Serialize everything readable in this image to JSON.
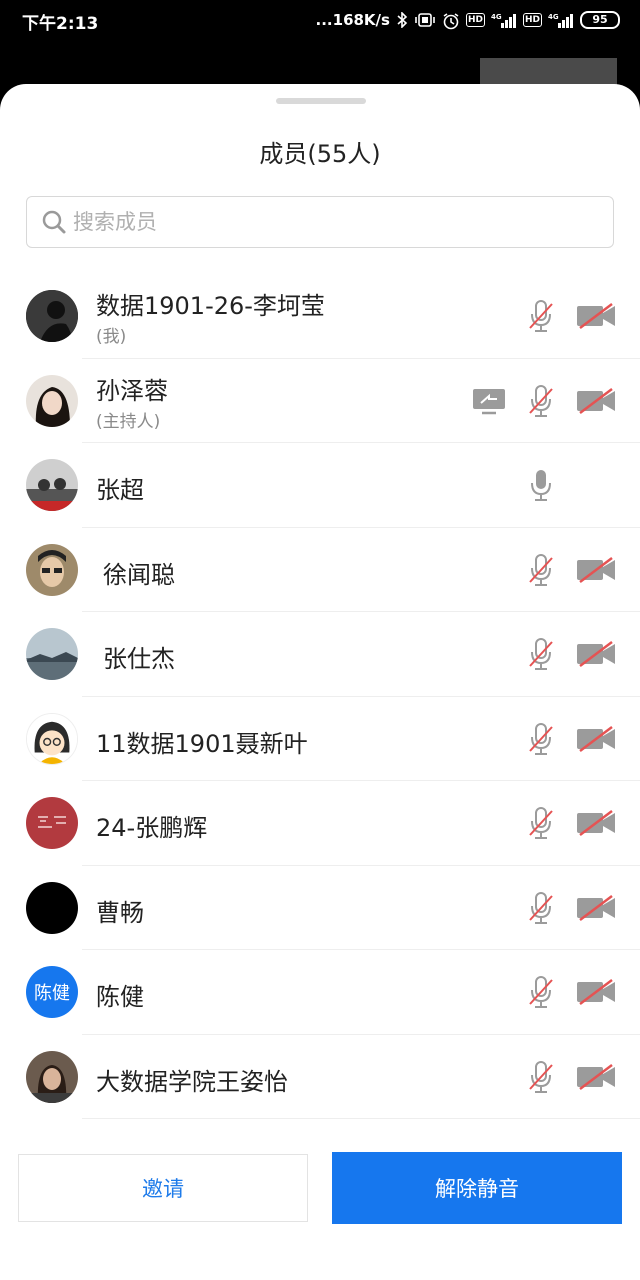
{
  "status_bar": {
    "time": "下午2:13",
    "speed": "...168K/s",
    "net1": "4G",
    "net2": "4G",
    "hd": "HD",
    "battery": "95"
  },
  "sheet": {
    "title": "成员(55人)"
  },
  "search": {
    "placeholder": "搜索成员"
  },
  "members": [
    {
      "name": "数据1901-26-李坷莹",
      "sub": "(我)",
      "avatar": "photo-silhouette",
      "mic_muted": true,
      "video_off": true,
      "sharing": false
    },
    {
      "name": "孙泽蓉",
      "sub": "(主持人)",
      "avatar": "photo-woman",
      "mic_muted": true,
      "video_off": true,
      "sharing": true
    },
    {
      "name": "张超",
      "avatar": "photo-group",
      "mic_muted": false,
      "video_off": null,
      "sharing": false
    },
    {
      "name": "徐闻聪",
      "avatar": "photo-man",
      "mic_muted": true,
      "video_off": true,
      "sharing": false
    },
    {
      "name": "张仕杰",
      "avatar": "photo-landscape",
      "mic_muted": true,
      "video_off": true,
      "sharing": false
    },
    {
      "name": "11数据1901聂新叶",
      "avatar": "cartoon-girl",
      "mic_muted": true,
      "video_off": true,
      "sharing": false
    },
    {
      "name": "24-张鹏辉",
      "avatar": "photo-red-text",
      "mic_muted": true,
      "video_off": true,
      "sharing": false
    },
    {
      "name": "曹畅",
      "avatar": "black-circle",
      "mic_muted": true,
      "video_off": true,
      "sharing": false
    },
    {
      "name": "陈健",
      "avatar_text": "陈健",
      "avatar": "blue-text",
      "mic_muted": true,
      "video_off": true,
      "sharing": false
    },
    {
      "name": "大数据学院王姿怡",
      "avatar": "photo-person",
      "mic_muted": true,
      "video_off": true,
      "sharing": false
    }
  ],
  "buttons": {
    "invite": "邀请",
    "unmute": "解除静音"
  },
  "colors": {
    "accent": "#1677ee",
    "muted_red": "#e55353",
    "icon_gray": "#9b9b9b"
  }
}
